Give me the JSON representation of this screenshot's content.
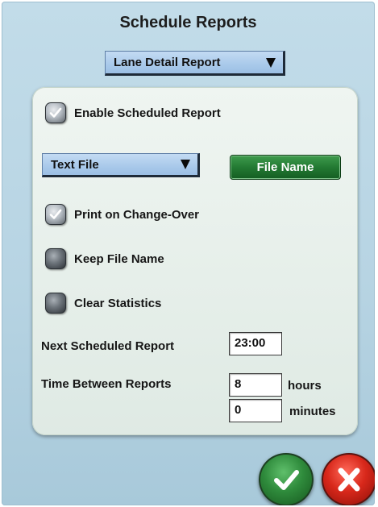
{
  "window": {
    "title": "Schedule Reports"
  },
  "report_select": {
    "value": "Lane Detail Report",
    "icon": "dropdown-arrow-icon"
  },
  "enable_scheduled": {
    "label": "Enable Scheduled Report",
    "checked": true
  },
  "output_select": {
    "value": "Text File",
    "icon": "dropdown-arrow-icon"
  },
  "file_name_button": {
    "label": "File Name",
    "color": "#237a33"
  },
  "print_on_changeover": {
    "label": "Print on Change-Over",
    "checked": true
  },
  "keep_file_name": {
    "label": "Keep File Name",
    "checked": false
  },
  "clear_statistics": {
    "label": "Clear Statistics",
    "checked": false
  },
  "next_report": {
    "label": "Next Scheduled Report",
    "value": "23:00"
  },
  "time_between": {
    "label": "Time Between Reports",
    "hours_value": "8",
    "hours_unit": "hours",
    "minutes_value": "0",
    "minutes_unit": "minutes"
  },
  "actions": {
    "ok": {
      "icon": "checkmark-icon",
      "color": "#2f8b3c"
    },
    "cancel": {
      "icon": "x-icon",
      "color": "#d8281b"
    }
  }
}
